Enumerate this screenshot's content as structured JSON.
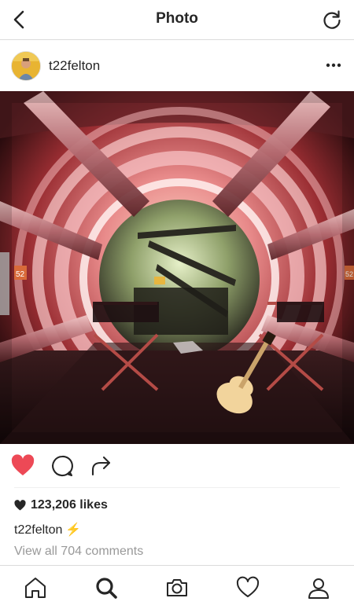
{
  "header": {
    "title": "Photo"
  },
  "post": {
    "username": "t22felton",
    "likes": "123,206 likes",
    "caption_user": "t22felton",
    "caption_emoji": "⚡",
    "comments_link": "View all 704 comments",
    "liked": true,
    "photo_signs": {
      "left_tag": "52",
      "right_tag": "52"
    }
  },
  "colors": {
    "like_red": "#ed4956",
    "text": "#262626",
    "muted": "#999999",
    "border": "#dbdbdb"
  },
  "icons": {
    "top_left": "back-chevron-icon",
    "top_right": "refresh-icon",
    "more": "more-dots-icon",
    "actions": [
      "heart-icon",
      "comment-icon",
      "share-icon"
    ],
    "tabs": [
      "home-icon",
      "search-icon",
      "camera-icon",
      "activity-heart-icon",
      "profile-icon"
    ]
  }
}
